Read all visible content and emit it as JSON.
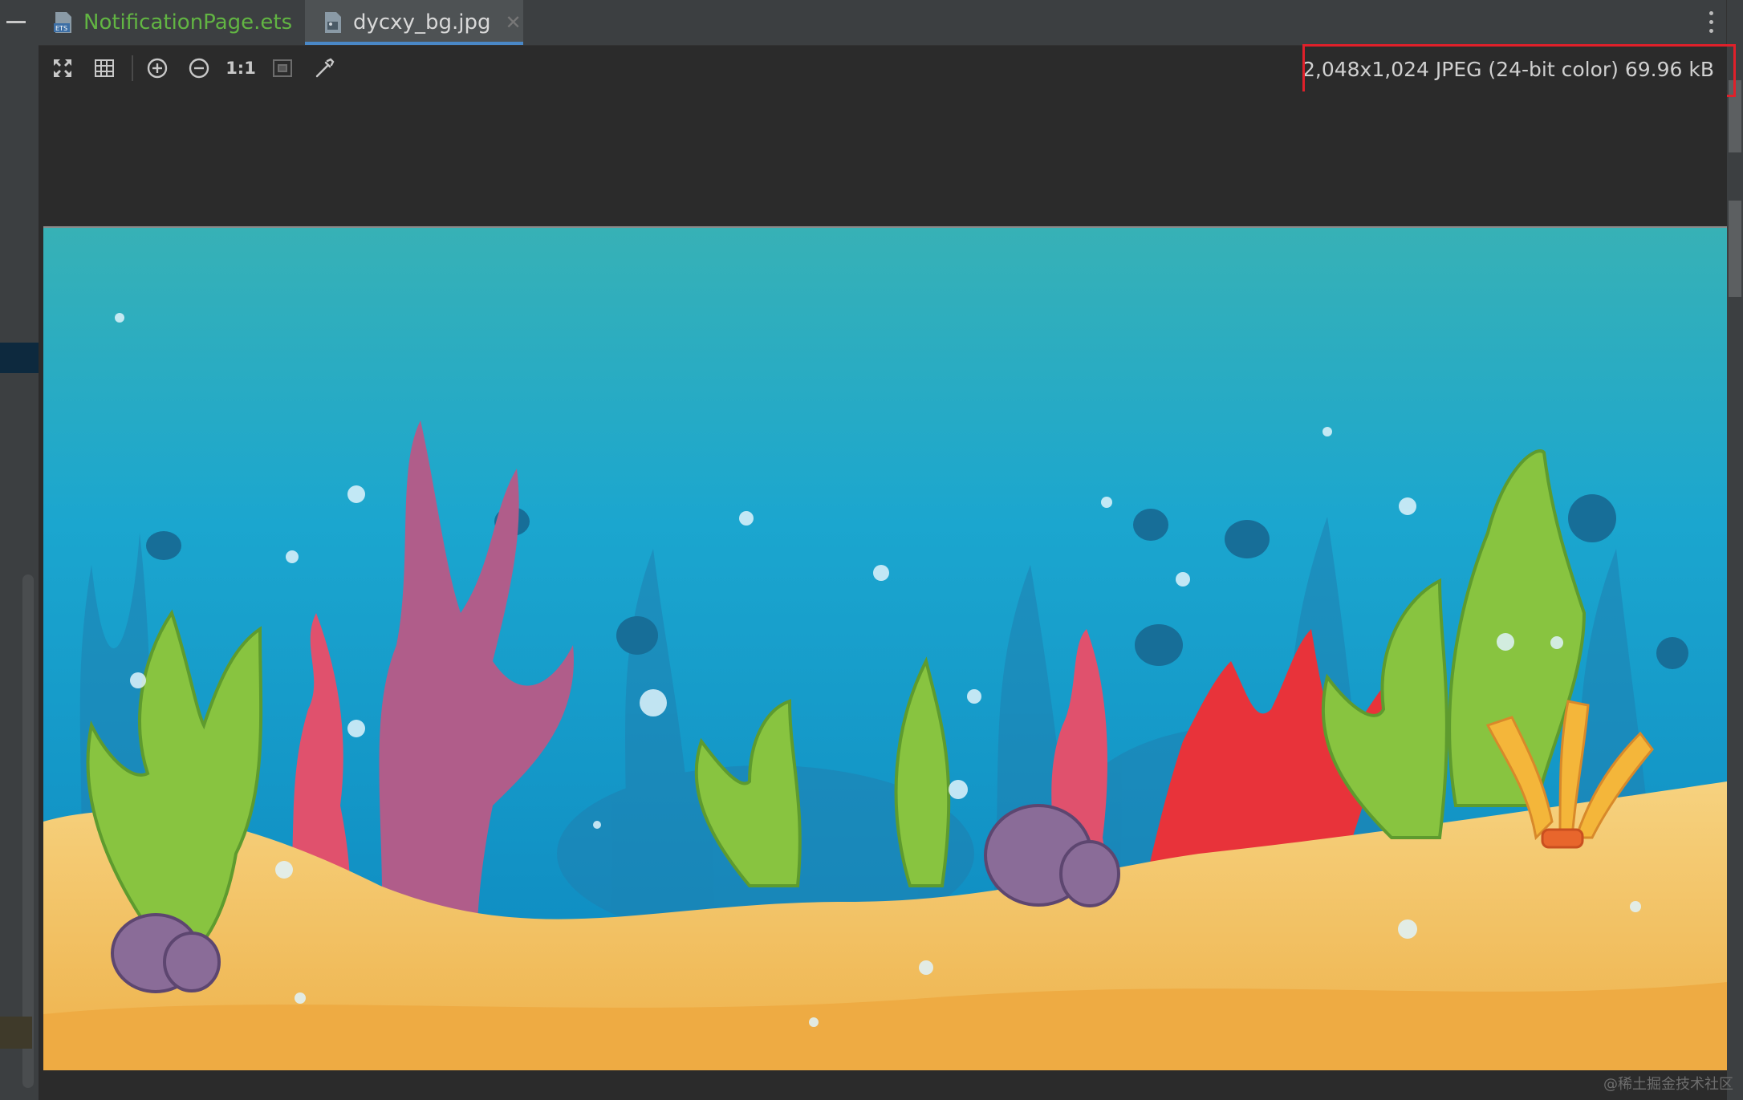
{
  "tabs": [
    {
      "label": "NotificationPage.ets",
      "active": false,
      "icon": "ets-file-icon",
      "color": "#62b543"
    },
    {
      "label": "dycxy_bg.jpg",
      "active": true,
      "icon": "image-file-icon",
      "color": "#d8d8d8"
    }
  ],
  "toolbar": {
    "tools": [
      "fit-to-window-icon",
      "grid-icon",
      "zoom-in-icon",
      "zoom-out-icon",
      "actual-size-icon",
      "background-icon",
      "color-picker-icon"
    ],
    "actual_size_label": "1:1"
  },
  "image_info": "2,048x1,024 JPEG (24-bit color) 69.96 kB",
  "highlight_color": "#e0202a",
  "image": {
    "subject": "underwater-seabed-illustration"
  },
  "watermark": "@稀土掘金技术社区"
}
